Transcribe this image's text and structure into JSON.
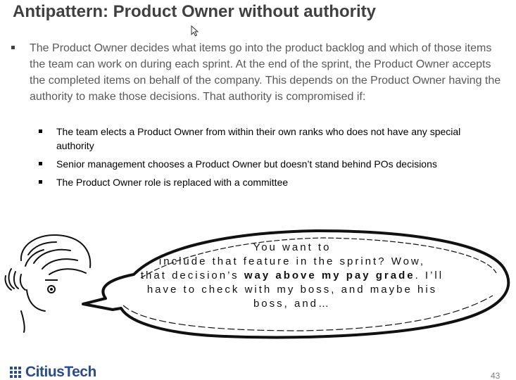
{
  "slide": {
    "title": "Antipattern: Product Owner without authority",
    "main_bullet": "The Product Owner decides what items go into the product backlog and which of those items the team can work on during each sprint. At the end of the sprint, the Product  Owner accepts the completed items on behalf of the company. This depends on the Product Owner having the  authority to make those decisions. That authority is  compromised if:",
    "sub_bullets": [
      "The team elects a Product Owner from within their own ranks who does not have any special authority",
      "Senior management chooses a Product Owner but doesn’t stand behind POs decisions",
      "The Product Owner role is replaced with a committee"
    ]
  },
  "speech_bubble": {
    "line1": "You want to",
    "line2": "include that feature in the sprint? Wow,",
    "line3_before": "that decision’s ",
    "line3_bold": "way above my pay grade",
    "line3_after": ". I’ll",
    "line4": "have to check with my boss, and maybe his",
    "line5": "boss, and…"
  },
  "footer": {
    "logo_text": "CitiusTech",
    "page_number": "43"
  },
  "colors": {
    "title": "#404040",
    "body_text": "#595959",
    "logo": "#2a4b8c"
  },
  "icons": {
    "cursor": "mouse-pointer-icon",
    "logo": "citiustech-logo-icon",
    "drawing": "worried-person-drawing"
  }
}
